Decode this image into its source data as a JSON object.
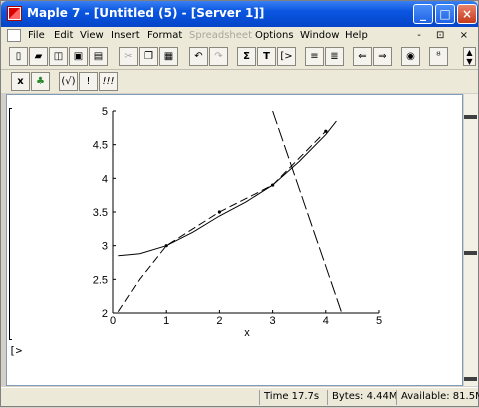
{
  "window": {
    "title": "Maple 7  - [Untitled (5) - [Server 1]]"
  },
  "title_buttons": {
    "minimize": "_",
    "maximize": "□",
    "close": "×"
  },
  "menu": [
    {
      "label": "File",
      "disabled": false
    },
    {
      "label": "Edit",
      "disabled": false
    },
    {
      "label": "View",
      "disabled": false
    },
    {
      "label": "Insert",
      "disabled": false
    },
    {
      "label": "Format",
      "disabled": false
    },
    {
      "label": "Spreadsheet",
      "disabled": true
    },
    {
      "label": "Options",
      "disabled": false
    },
    {
      "label": "Window",
      "disabled": false
    },
    {
      "label": "Help",
      "disabled": false
    }
  ],
  "mdi_controls": "- ⊡ ×",
  "toolbar1": [
    "new-document",
    "open",
    "open-url",
    "save",
    "print",
    "cut",
    "copy",
    "paste",
    "undo",
    "redo",
    "sum",
    "text",
    "input",
    "indent",
    "outdent",
    "back",
    "forward",
    "stop",
    "zoom"
  ],
  "toolbar2": {
    "x_label": "x",
    "leaf_label": "♣",
    "check_label": "(√)",
    "bang_label": "!",
    "triple_label": "!!!"
  },
  "toolbar1_labels": {
    "sum": "Σ",
    "text": "T",
    "input": "[>"
  },
  "chart_data": {
    "type": "line",
    "xlabel": "x",
    "ylabel": "",
    "title": "",
    "xlim": [
      0,
      5
    ],
    "ylim": [
      2,
      5
    ],
    "xticks": [
      "0",
      "1",
      "2",
      "3",
      "4",
      "5"
    ],
    "yticks": [
      "2",
      "2.5",
      "3",
      "3.5",
      "4",
      "4.5",
      "5"
    ],
    "series": [
      {
        "style": "solid",
        "x": [
          0.1,
          0.5,
          1,
          1.5,
          2,
          2.5,
          3,
          3.5,
          4,
          4.1,
          4.2
        ],
        "y": [
          2.85,
          2.88,
          3.0,
          3.2,
          3.44,
          3.65,
          3.9,
          4.25,
          4.65,
          4.75,
          4.85
        ]
      },
      {
        "style": "dash",
        "x": [
          0.1,
          0.5,
          1,
          2,
          3,
          4
        ],
        "y": [
          2.02,
          2.5,
          3.0,
          3.5,
          3.9,
          4.7
        ]
      },
      {
        "style": "longdash",
        "x": [
          3.0,
          4.3
        ],
        "y": [
          5.0,
          2.0
        ]
      }
    ],
    "points": [
      {
        "x": 1,
        "y": 3.0
      },
      {
        "x": 2,
        "y": 3.5
      },
      {
        "x": 3,
        "y": 3.9
      },
      {
        "x": 4,
        "y": 4.7
      }
    ]
  },
  "prompt": "[>",
  "status": {
    "time": "Time  17.7s",
    "bytes": "Bytes: 4.44M",
    "available": "Available: 81.5M"
  }
}
